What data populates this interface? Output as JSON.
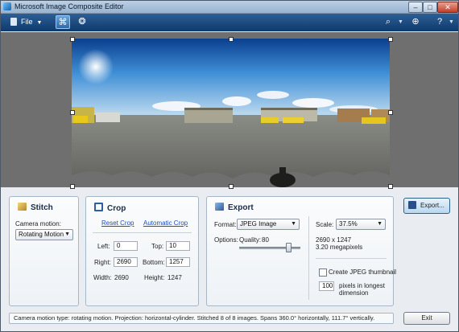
{
  "window": {
    "title": "Microsoft Image Composite Editor"
  },
  "titlebar_buttons": {
    "minimize": "–",
    "maximize": "□",
    "close": "✕"
  },
  "toolbar": {
    "file_label": "File",
    "stitch_view_icon": "stitch-view-icon",
    "globe_icon": "globe-icon",
    "zoom_icon": "zoom-icon",
    "fit_icon": "fit-icon",
    "help_icon": "help-icon"
  },
  "stitch": {
    "title": "Stitch",
    "camera_motion_label": "Camera motion:",
    "camera_motion_value": "Rotating Motion"
  },
  "crop": {
    "title": "Crop",
    "reset_label": "Reset Crop",
    "auto_label": "Automatic Crop",
    "left_label": "Left:",
    "left_value": "0",
    "top_label": "Top:",
    "top_value": "10",
    "right_label": "Right:",
    "right_value": "2690",
    "bottom_label": "Bottom:",
    "bottom_value": "1257",
    "width_label": "Width:",
    "width_value": "2690",
    "height_label": "Height:",
    "height_value": "1247"
  },
  "export": {
    "title": "Export",
    "format_label": "Format:",
    "format_value": "JPEG Image",
    "options_label": "Options:",
    "quality_label": "Quality:",
    "quality_value": "80",
    "quality_level": 0.8,
    "scale_label": "Scale:",
    "scale_value": "37.5%",
    "dimensions": "2690 x 1247",
    "megapixels": "3.20 megapixels",
    "thumbnail_label": "Create JPEG thumbnail",
    "thumbnail_checked": false,
    "thumbnail_size": "100",
    "thumbnail_hint_1": "pixels in longest",
    "thumbnail_hint_2": "dimension",
    "export_button": "Export..."
  },
  "status": {
    "text": "Camera motion type: rotating motion. Projection: horizontal-cylinder. Stitched 8 of 8 images. Spans 360.0° horizontally, 111.7° vertically."
  },
  "exit_button": "Exit"
}
